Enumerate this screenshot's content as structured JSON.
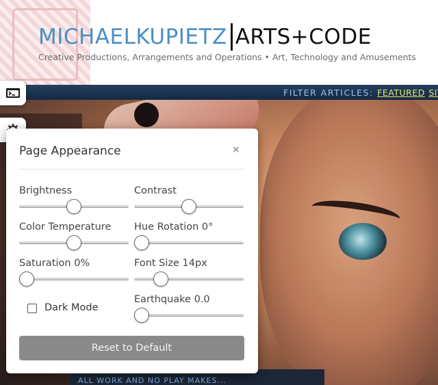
{
  "header": {
    "logo_name": "MICHAELKUPIETZ",
    "logo_brand": "ARTS+CODE",
    "tagline": "Creative Productions, Arrangements and Operations • Art, Technology and Amusements"
  },
  "filter_bar": {
    "label": "FILTER ARTICLES:",
    "links": [
      "FEATURED",
      "SITE"
    ]
  },
  "hero": {
    "bottom_text": "ALL WORK AND NO PLAY MAKES..."
  },
  "side_tabs": [
    {
      "icon": "terminal-icon"
    },
    {
      "icon": "gear-icon"
    }
  ],
  "panel": {
    "title": "Page Appearance",
    "close": "×",
    "controls": {
      "brightness": {
        "label": "Brightness",
        "value": 0.5
      },
      "contrast": {
        "label": "Contrast",
        "value": 0.5
      },
      "color_temperature": {
        "label": "Color Temperature",
        "value": 0.5
      },
      "hue_rotation": {
        "label": "Hue Rotation 0°",
        "value": 0.0
      },
      "saturation": {
        "label": "Saturation 0%",
        "value": 0.0
      },
      "font_size": {
        "label": "Font Size 14px",
        "value": 0.2
      },
      "earthquake": {
        "label": "Earthquake 0.0",
        "value": 0.0
      }
    },
    "dark_mode": {
      "label": "Dark Mode",
      "checked": false
    },
    "reset_label": "Reset to Default"
  },
  "colors": {
    "logo_blue": "#4a8fc4",
    "filter_bar": "#1c3451",
    "filter_link": "#e8e86a",
    "reset_button": "#8a8a8a"
  }
}
